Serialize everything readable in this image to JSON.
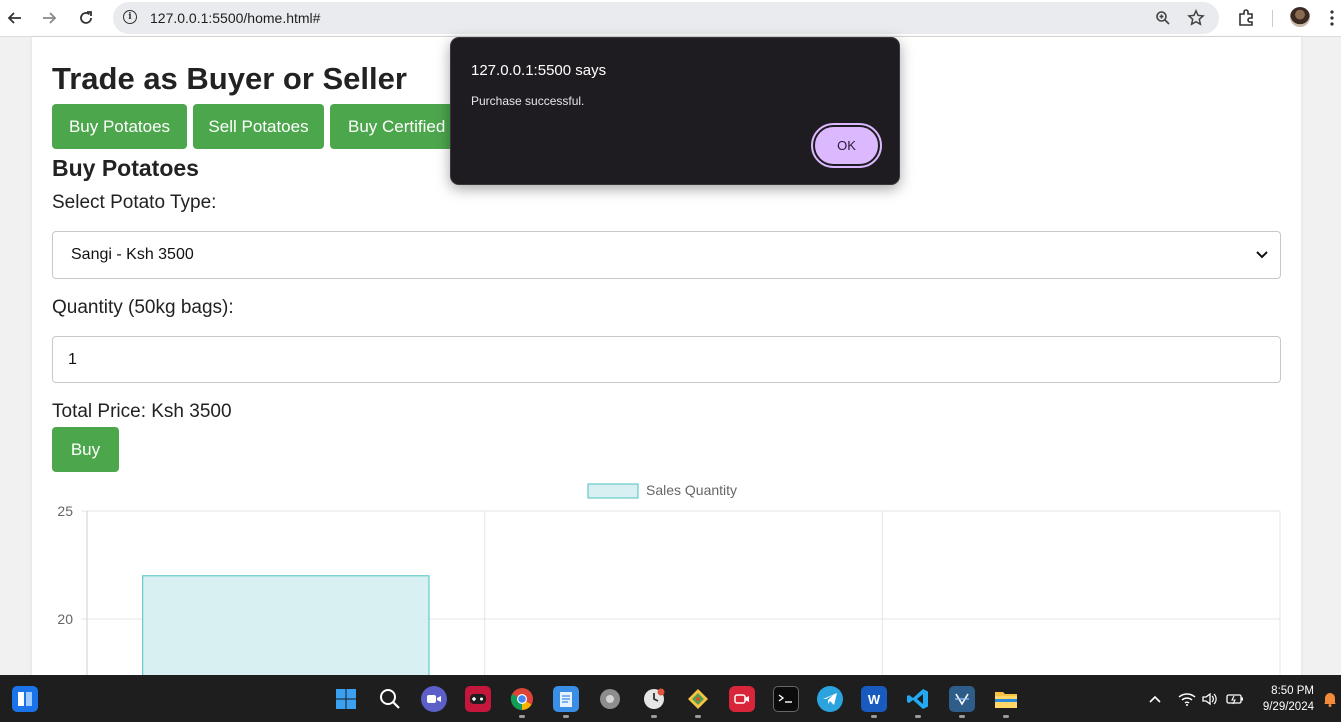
{
  "browser": {
    "url": "127.0.0.1:5500/home.html#",
    "icons": [
      "back-arrow-icon",
      "forward-arrow-icon",
      "reload-icon",
      "site-info-icon",
      "zoom-icon",
      "bookmark-star-icon",
      "extensions-icon",
      "profile-avatar",
      "menu-icon"
    ]
  },
  "page": {
    "title": "Trade as Buyer or Seller",
    "tabs": [
      "Buy Potatoes",
      "Sell Potatoes",
      "Buy Certified"
    ],
    "section_title": "Buy Potatoes",
    "select_label": "Select Potato Type:",
    "select_value": "Sangi - Ksh 3500",
    "quantity_label": "Quantity (50kg bags):",
    "quantity_value": "1",
    "total_price": "Total Price: Ksh 3500",
    "buy_label": "Buy",
    "accent_color": "#4ca64c"
  },
  "chart_data": {
    "type": "bar",
    "legend": [
      "Sales Quantity"
    ],
    "legend_position": "top",
    "series": [
      {
        "name": "Sales Quantity",
        "values": [
          22
        ]
      }
    ],
    "y_ticks": [
      25,
      20
    ],
    "ylim": [
      0,
      25
    ],
    "grid": true,
    "bar_color": "#d8f0f2",
    "bar_border": "#4bc0c0"
  },
  "dialog": {
    "origin": "127.0.0.1:5500 says",
    "message": "Purchase successful.",
    "ok_label": "OK"
  },
  "taskbar": {
    "apps": [
      "widgets-icon",
      "start-icon",
      "search-icon",
      "meet-icon",
      "game-icon",
      "chrome-icon",
      "notepad-icon",
      "disc-icon",
      "clock-icon",
      "git-icon",
      "recorder-icon",
      "terminal-icon",
      "telegram-icon",
      "word-icon",
      "vscode-icon",
      "virtualbox-icon",
      "file-explorer-icon"
    ],
    "time": "8:50 PM",
    "date": "9/29/2024"
  }
}
